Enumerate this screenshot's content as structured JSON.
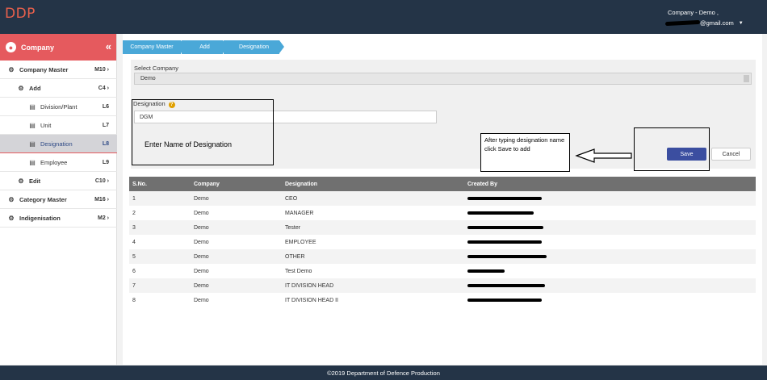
{
  "app": {
    "logo": "DDP"
  },
  "user": {
    "company": "Company - Demo ,",
    "email_visible": "@gmail.com",
    "caret": "▼"
  },
  "sidebar": {
    "header": "Company",
    "items": [
      {
        "label": "Company Master",
        "code": "M10",
        "level": 0
      },
      {
        "label": "Add",
        "code": "C4",
        "level": 1
      },
      {
        "label": "Division/Plant",
        "code": "L6",
        "level": 2
      },
      {
        "label": "Unit",
        "code": "L7",
        "level": 2
      },
      {
        "label": "Designation",
        "code": "L8",
        "level": 2,
        "active": true
      },
      {
        "label": "Employee",
        "code": "L9",
        "level": 2
      },
      {
        "label": "Edit",
        "code": "C10",
        "level": 1
      },
      {
        "label": "Category Master",
        "code": "M16",
        "level": 0
      },
      {
        "label": "Indigenisation",
        "code": "M2",
        "level": 0
      }
    ]
  },
  "breadcrumb": [
    "Company Master",
    "Add",
    "Designation"
  ],
  "form": {
    "select_label": "Select Company",
    "select_value": "Demo",
    "designation_label": "Designation",
    "designation_help": "?",
    "designation_value": "DGM"
  },
  "annotations": {
    "enter_name": "Enter Name of Designation",
    "note": "After typing designation name click Save to add"
  },
  "buttons": {
    "save": "Save",
    "cancel": "Cancel"
  },
  "table": {
    "headers": [
      "S.No.",
      "Company",
      "Designation",
      "Created By"
    ],
    "rows": [
      {
        "sno": "1",
        "company": "Demo",
        "designation": "CEO"
      },
      {
        "sno": "2",
        "company": "Demo",
        "designation": "MANAGER"
      },
      {
        "sno": "3",
        "company": "Demo",
        "designation": "Tester"
      },
      {
        "sno": "4",
        "company": "Demo",
        "designation": "EMPLOYEE"
      },
      {
        "sno": "5",
        "company": "Demo",
        "designation": "OTHER"
      },
      {
        "sno": "6",
        "company": "Demo",
        "designation": "Test Demo"
      },
      {
        "sno": "7",
        "company": "Demo",
        "designation": "IT DIVISION HEAD"
      },
      {
        "sno": "8",
        "company": "Demo",
        "designation": "IT DIVISION HEAD II"
      }
    ]
  },
  "footer": {
    "text": "©2019 Department of Defence Production"
  },
  "colors": {
    "topbar": "#243447",
    "accent": "#e55a5e",
    "breadcrumb": "#4aa8d8",
    "save": "#3b4ea0",
    "logo": "#e8604c"
  }
}
